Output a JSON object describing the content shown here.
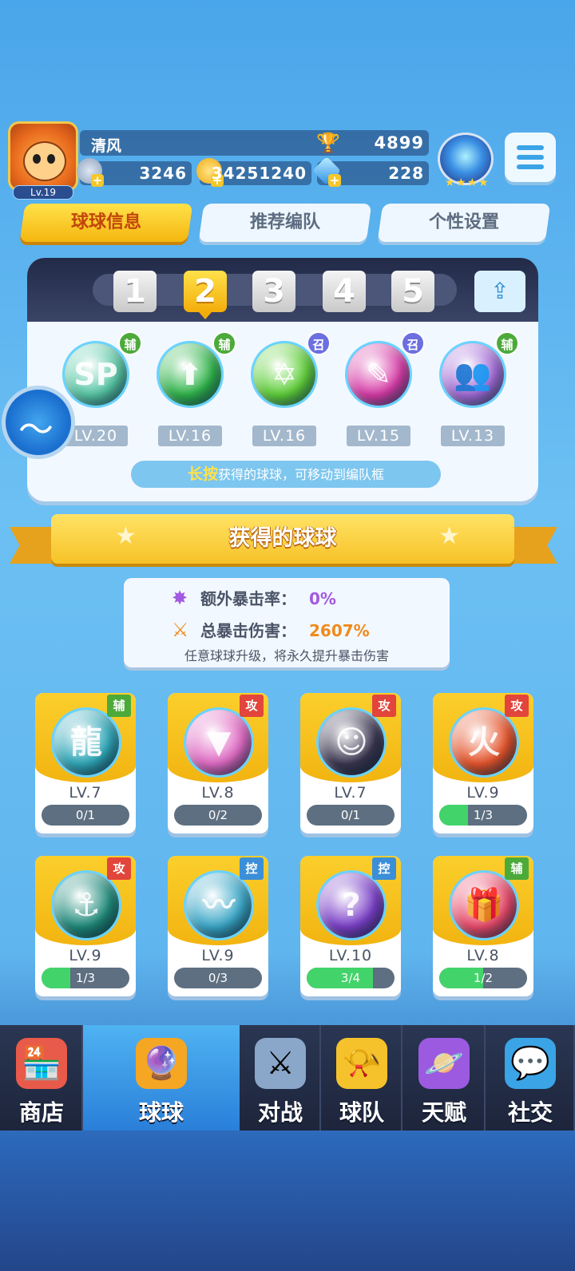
{
  "player": {
    "name": "清风",
    "level": "Lv.19",
    "trophies": "4899",
    "currency1": "3246",
    "coins": "34251240",
    "gems": "228"
  },
  "top_tabs": [
    "球球信息",
    "推荐编队",
    "个性设置"
  ],
  "team": {
    "slots": [
      "1",
      "2",
      "3",
      "4",
      "5"
    ],
    "active_slot": "2",
    "balls": [
      {
        "tag": "辅",
        "level": "LV.20",
        "color": "#58c8a6",
        "glyph": "SP"
      },
      {
        "tag": "辅",
        "level": "LV.16",
        "color": "#2fb54a",
        "glyph": "⬆"
      },
      {
        "tag": "召",
        "level": "LV.16",
        "color": "#5fd03a",
        "glyph": "✡"
      },
      {
        "tag": "召",
        "level": "LV.15",
        "color": "#d83ca8",
        "glyph": "✎"
      },
      {
        "tag": "辅",
        "level": "LV.13",
        "color": "#a36bd8",
        "glyph": "👥"
      }
    ],
    "hint_emph": "长按",
    "hint_rest": "获得的球球，可移动到编队框"
  },
  "section_title": "获得的球球",
  "crit": {
    "extra_rate_label": "额外暴击率：",
    "extra_rate_value": "0%",
    "total_dmg_label": "总暴击伤害：",
    "total_dmg_value": "2607%",
    "note": "任意球球升级，将永久提升暴击伤害"
  },
  "owned_balls": [
    {
      "tag": "辅",
      "tag_color": "green",
      "level": "LV.7",
      "progress_text": "0/1",
      "progress": 0,
      "color": "#2fa7b8",
      "glyph": "龍"
    },
    {
      "tag": "攻",
      "tag_color": "red",
      "level": "LV.8",
      "progress_text": "0/2",
      "progress": 0,
      "color": "#e06ac4",
      "glyph": "▼"
    },
    {
      "tag": "攻",
      "tag_color": "red",
      "level": "LV.7",
      "progress_text": "0/1",
      "progress": 0,
      "color": "#3a3550",
      "glyph": "☺"
    },
    {
      "tag": "攻",
      "tag_color": "red",
      "level": "LV.9",
      "progress_text": "1/3",
      "progress": 0.33,
      "color": "#e5542b",
      "glyph": "火"
    },
    {
      "tag": "攻",
      "tag_color": "red",
      "level": "LV.9",
      "progress_text": "1/3",
      "progress": 0.33,
      "color": "#1f8a7a",
      "glyph": "⚓"
    },
    {
      "tag": "控",
      "tag_color": "blue",
      "level": "LV.9",
      "progress_text": "0/3",
      "progress": 0,
      "color": "#3aa7c8",
      "glyph": "〰"
    },
    {
      "tag": "控",
      "tag_color": "blue",
      "level": "LV.10",
      "progress_text": "3/4",
      "progress": 0.75,
      "color": "#7a3fc8",
      "glyph": "?"
    },
    {
      "tag": "辅",
      "tag_color": "green",
      "level": "LV.8",
      "progress_text": "1/2",
      "progress": 0.5,
      "color": "#e84a6a",
      "glyph": "🎁"
    }
  ],
  "nav": [
    {
      "label": "商店",
      "icon": "shop-icon",
      "active": false
    },
    {
      "label": "球球",
      "icon": "balls-icon",
      "active": true
    },
    {
      "label": "对战",
      "icon": "swords-icon",
      "active": false
    },
    {
      "label": "球队",
      "icon": "whistle-icon",
      "active": false
    },
    {
      "label": "天赋",
      "icon": "planet-icon",
      "active": false
    },
    {
      "label": "社交",
      "icon": "chat-icon",
      "active": false
    }
  ],
  "colors": {
    "accent_yellow": "#f7c228",
    "progress_green": "#42d46a",
    "crit_purple": "#a25ae0",
    "crit_orange": "#f08a1c"
  }
}
